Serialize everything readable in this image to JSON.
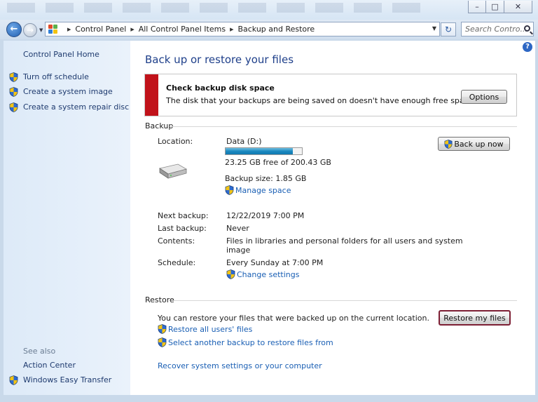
{
  "window": {
    "minimize": "–",
    "maximize": "□",
    "close": "✕"
  },
  "nav": {
    "breadcrumb": [
      "Control Panel",
      "All Control Panel Items",
      "Backup and Restore"
    ],
    "search_placeholder": "Search Contro...",
    "refresh_symbol": "↻"
  },
  "sidebar": {
    "home": "Control Panel Home",
    "tasks": [
      "Turn off schedule",
      "Create a system image",
      "Create a system repair disc"
    ],
    "see_also_label": "See also",
    "see_also": [
      "Action Center",
      "Windows Easy Transfer"
    ]
  },
  "main": {
    "title": "Back up or restore your files",
    "help": "?",
    "alert": {
      "title": "Check backup disk space",
      "text": "The disk that your backups are being saved on doesn't have enough free space.",
      "button": "Options",
      "accent_color": "#c1121a"
    },
    "backup": {
      "section": "Backup",
      "location_label": "Location:",
      "location_value": "Data (D:)",
      "disk_used_fraction": 0.88,
      "free_space": "23.25 GB free of 200.43 GB",
      "backup_size": "Backup size: 1.85 GB",
      "manage_space": "Manage space",
      "backup_now": "Back up now",
      "next_backup_label": "Next backup:",
      "next_backup": "12/22/2019 7:00 PM",
      "last_backup_label": "Last backup:",
      "last_backup": "Never",
      "contents_label": "Contents:",
      "contents_line1": "Files in libraries and personal folders for all users and system",
      "contents_line2": "image",
      "schedule_label": "Schedule:",
      "schedule": "Every Sunday at 7:00 PM",
      "change_settings": "Change settings"
    },
    "restore": {
      "section": "Restore",
      "text": "You can restore your files that were backed up on the current location.",
      "restore_my_files": "Restore my files",
      "restore_all_users": "Restore all users' files",
      "select_another": "Select another backup to restore files from",
      "recover_system": "Recover system settings or your computer"
    }
  },
  "colors": {
    "link": "#1a5fb4",
    "title": "#1e3f8a",
    "sidebar_link": "#1e3a6e"
  }
}
